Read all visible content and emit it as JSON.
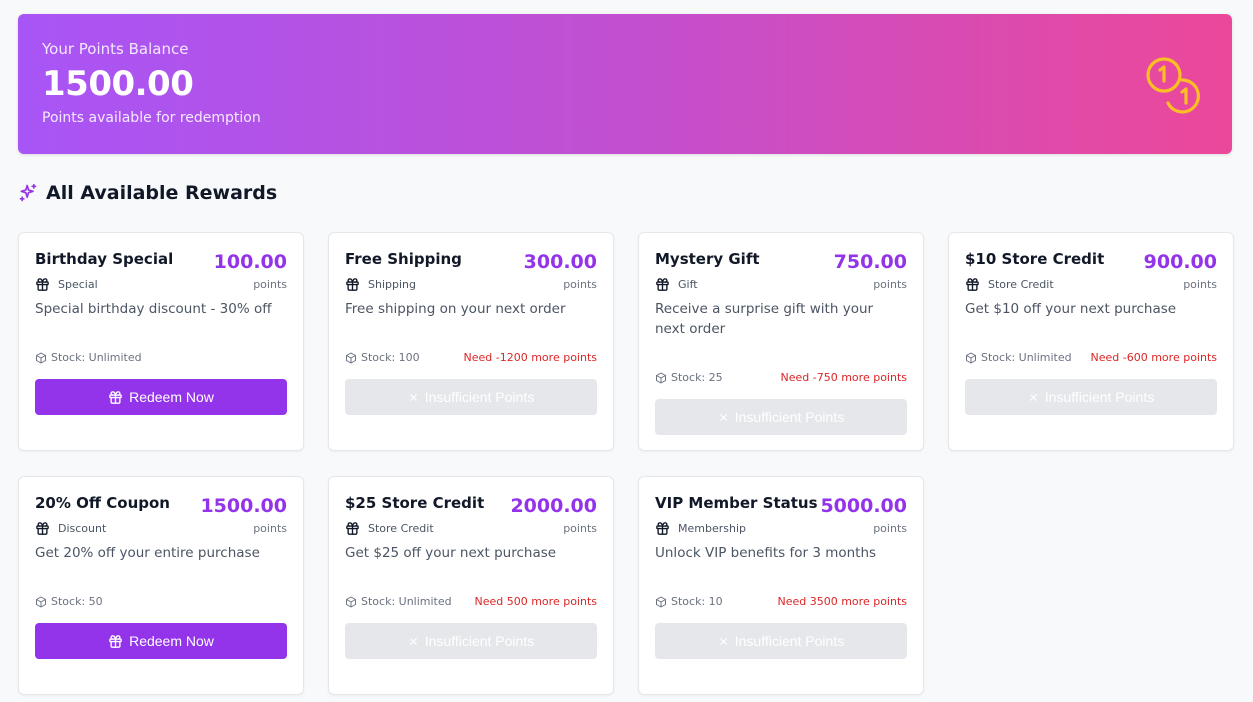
{
  "balance_card": {
    "label": "Your Points Balance",
    "balance": "1500.00",
    "subtext": "Points available for redemption",
    "icon": "coins-icon",
    "colors": {
      "gradient_start": "#a855f7",
      "gradient_end": "#ec4899",
      "coin": "#fbbf24"
    }
  },
  "section": {
    "title": "All Available Rewards",
    "icon": "sparkles-icon"
  },
  "labels": {
    "points_unit": "points",
    "redeem": "Redeem Now",
    "insufficient": "Insufficient Points"
  },
  "colors": {
    "accent": "#9333ea",
    "need": "#dc2626",
    "disabled": "#e5e7eb"
  },
  "rewards": [
    {
      "name": "Birthday Special",
      "price": "100.00",
      "category": "Special",
      "description": "Special birthday discount - 30% off",
      "stock": "Stock: Unlimited",
      "need": "",
      "can_redeem": true
    },
    {
      "name": "Free Shipping",
      "price": "300.00",
      "category": "Shipping",
      "description": "Free shipping on your next order",
      "stock": "Stock: 100",
      "need": "Need -1200 more points",
      "can_redeem": false
    },
    {
      "name": "Mystery Gift",
      "price": "750.00",
      "category": "Gift",
      "description": "Receive a surprise gift with your next order",
      "stock": "Stock: 25",
      "need": "Need -750 more points",
      "can_redeem": false
    },
    {
      "name": "$10 Store Credit",
      "price": "900.00",
      "category": "Store Credit",
      "description": "Get $10 off your next purchase",
      "stock": "Stock: Unlimited",
      "need": "Need -600 more points",
      "can_redeem": false
    },
    {
      "name": "20% Off Coupon",
      "price": "1500.00",
      "category": "Discount",
      "description": "Get 20% off your entire purchase",
      "stock": "Stock: 50",
      "need": "",
      "can_redeem": true
    },
    {
      "name": "$25 Store Credit",
      "price": "2000.00",
      "category": "Store Credit",
      "description": "Get $25 off your next purchase",
      "stock": "Stock: Unlimited",
      "need": "Need 500 more points",
      "can_redeem": false
    },
    {
      "name": "VIP Member Status",
      "price": "5000.00",
      "category": "Membership",
      "description": "Unlock VIP benefits for 3 months",
      "stock": "Stock: 10",
      "need": "Need 3500 more points",
      "can_redeem": false
    }
  ]
}
